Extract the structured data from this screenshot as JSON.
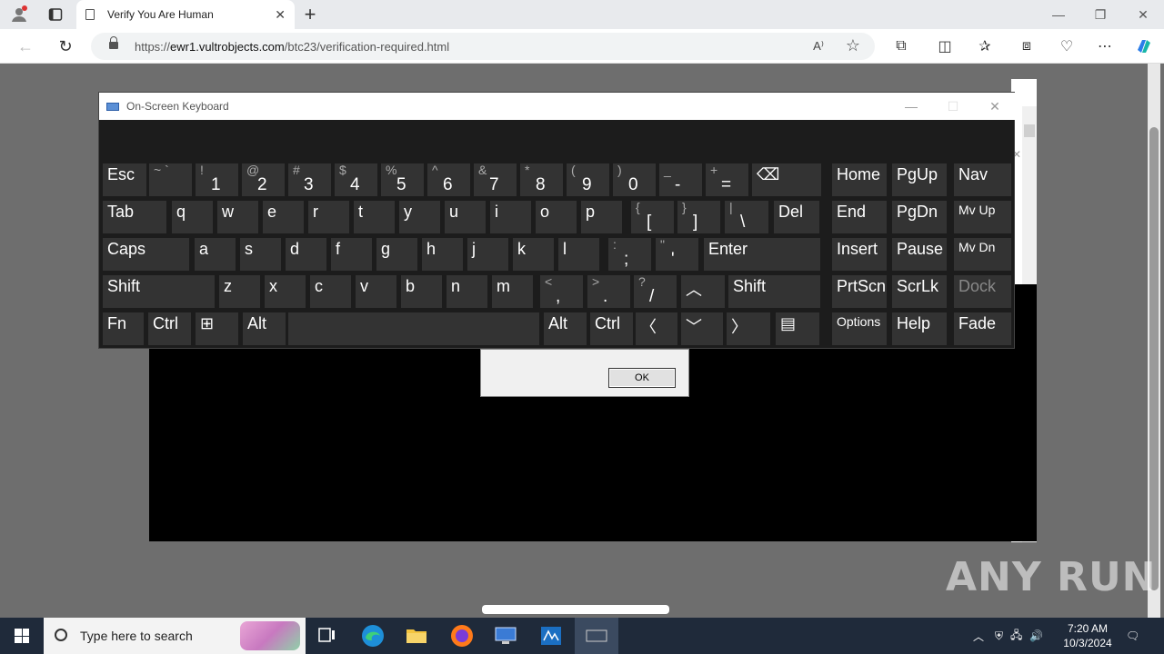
{
  "browser": {
    "tab_title": "Verify You Are Human",
    "url_prefix": "https://",
    "url_host": "ewr1.vultrobjects.com",
    "url_path": "/btc23/verification-required.html"
  },
  "dialog": {
    "ok_label": "OK"
  },
  "watermark": "ANY RUN",
  "osk": {
    "title": "On-Screen Keyboard",
    "rows": [
      [
        {
          "id": "esc",
          "label": "Esc"
        },
        {
          "id": "backtick",
          "sub": "~ `",
          "label": ""
        },
        {
          "id": "1",
          "sub": "!",
          "label": "1"
        },
        {
          "id": "2",
          "sub": "@",
          "label": "2"
        },
        {
          "id": "3",
          "sub": "#",
          "label": "3"
        },
        {
          "id": "4",
          "sub": "$",
          "label": "4"
        },
        {
          "id": "5",
          "sub": "%",
          "label": "5"
        },
        {
          "id": "6",
          "sub": "^",
          "label": "6"
        },
        {
          "id": "7",
          "sub": "&",
          "label": "7"
        },
        {
          "id": "8",
          "sub": "*",
          "label": "8"
        },
        {
          "id": "9",
          "sub": "(",
          "label": "9"
        },
        {
          "id": "0",
          "sub": ")",
          "label": "0"
        },
        {
          "id": "minus",
          "sub": "_",
          "label": "-"
        },
        {
          "id": "equals",
          "sub": "+",
          "label": "="
        },
        {
          "id": "backspace",
          "label": "⌫"
        },
        {
          "id": "home",
          "label": "Home"
        },
        {
          "id": "pgup",
          "label": "PgUp"
        },
        {
          "id": "nav",
          "label": "Nav"
        }
      ],
      [
        {
          "id": "tab",
          "label": "Tab"
        },
        {
          "id": "q",
          "label": "q"
        },
        {
          "id": "w",
          "label": "w"
        },
        {
          "id": "e",
          "label": "e"
        },
        {
          "id": "r",
          "label": "r"
        },
        {
          "id": "t",
          "label": "t"
        },
        {
          "id": "y",
          "label": "y"
        },
        {
          "id": "u",
          "label": "u"
        },
        {
          "id": "i",
          "label": "i"
        },
        {
          "id": "o",
          "label": "o"
        },
        {
          "id": "p",
          "label": "p"
        },
        {
          "id": "lbracket",
          "sub": "{",
          "label": "["
        },
        {
          "id": "rbracket",
          "sub": "}",
          "label": "]"
        },
        {
          "id": "backslash",
          "sub": "|",
          "label": "\\"
        },
        {
          "id": "del",
          "label": "Del"
        },
        {
          "id": "end",
          "label": "End"
        },
        {
          "id": "pgdn",
          "label": "PgDn"
        },
        {
          "id": "mvup",
          "label": "Mv Up"
        }
      ],
      [
        {
          "id": "caps",
          "label": "Caps"
        },
        {
          "id": "a",
          "label": "a"
        },
        {
          "id": "s",
          "label": "s"
        },
        {
          "id": "d",
          "label": "d"
        },
        {
          "id": "f",
          "label": "f"
        },
        {
          "id": "g",
          "label": "g"
        },
        {
          "id": "h",
          "label": "h"
        },
        {
          "id": "j",
          "label": "j"
        },
        {
          "id": "k",
          "label": "k"
        },
        {
          "id": "l",
          "label": "l"
        },
        {
          "id": "semicolon",
          "sub": ":",
          "label": ";"
        },
        {
          "id": "quote",
          "sub": "\"",
          "label": "'"
        },
        {
          "id": "enter",
          "label": "Enter"
        },
        {
          "id": "insert",
          "label": "Insert"
        },
        {
          "id": "pause",
          "label": "Pause"
        },
        {
          "id": "mvdn",
          "label": "Mv Dn"
        }
      ],
      [
        {
          "id": "lshift",
          "label": "Shift"
        },
        {
          "id": "z",
          "label": "z"
        },
        {
          "id": "x",
          "label": "x"
        },
        {
          "id": "c",
          "label": "c"
        },
        {
          "id": "v",
          "label": "v"
        },
        {
          "id": "b",
          "label": "b"
        },
        {
          "id": "n",
          "label": "n"
        },
        {
          "id": "m",
          "label": "m"
        },
        {
          "id": "comma",
          "sub": "<",
          "label": ","
        },
        {
          "id": "period",
          "sub": ">",
          "label": "."
        },
        {
          "id": "slash",
          "sub": "?",
          "label": "/"
        },
        {
          "id": "up",
          "label": "︿"
        },
        {
          "id": "rshift",
          "label": "Shift"
        },
        {
          "id": "prtscn",
          "label": "PrtScn"
        },
        {
          "id": "scrlk",
          "label": "ScrLk"
        },
        {
          "id": "dock",
          "label": "Dock"
        }
      ],
      [
        {
          "id": "fn",
          "label": "Fn"
        },
        {
          "id": "lctrl",
          "label": "Ctrl"
        },
        {
          "id": "win",
          "label": "⊞"
        },
        {
          "id": "lalt",
          "label": "Alt"
        },
        {
          "id": "space",
          "label": ""
        },
        {
          "id": "ralt",
          "label": "Alt"
        },
        {
          "id": "rctrl",
          "label": "Ctrl"
        },
        {
          "id": "left",
          "label": "〈"
        },
        {
          "id": "down",
          "label": "﹀"
        },
        {
          "id": "right",
          "label": "〉"
        },
        {
          "id": "menu",
          "label": "▤"
        },
        {
          "id": "options",
          "label": "Options"
        },
        {
          "id": "help",
          "label": "Help"
        },
        {
          "id": "fade",
          "label": "Fade"
        }
      ]
    ]
  },
  "taskbar": {
    "search_placeholder": "Type here to search",
    "time": "7:20 AM",
    "date": "10/3/2024"
  }
}
